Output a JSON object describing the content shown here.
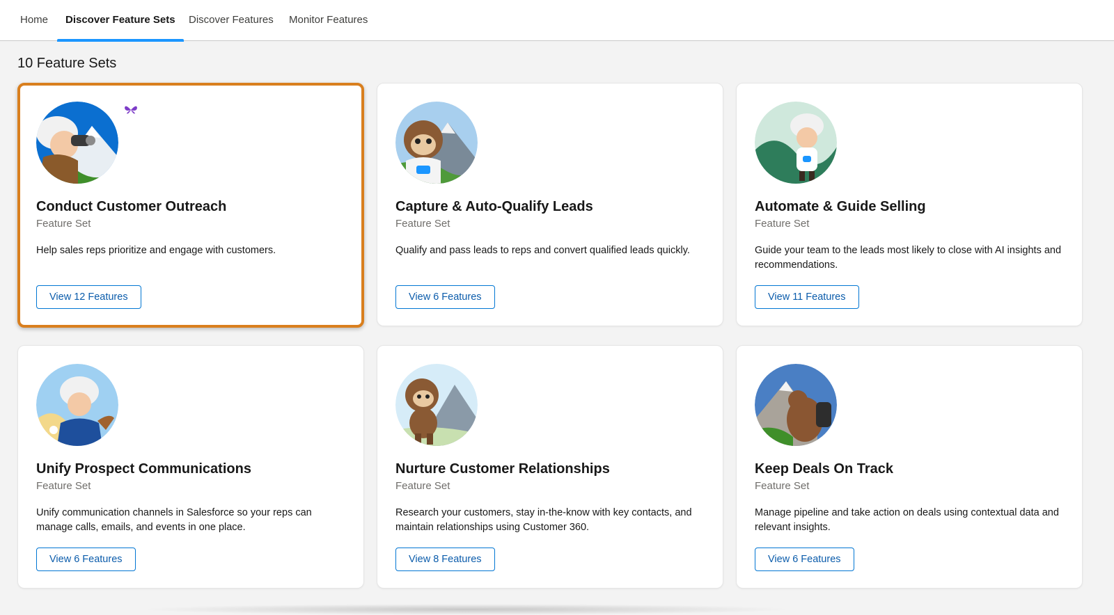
{
  "nav": {
    "tabs": [
      {
        "label": "Home"
      },
      {
        "label": "Discover Feature Sets"
      },
      {
        "label": "Discover Features"
      },
      {
        "label": "Monitor Features"
      }
    ],
    "active_tab": "Discover Feature Sets",
    "accent_color": "#1b96ff"
  },
  "main": {
    "count_label": "10 Feature Sets",
    "cards": [
      {
        "title": "Conduct Customer Outreach",
        "subtitle": "Feature Set",
        "description": "Help sales reps prioritize and engage with customers.",
        "button": "View 12 Features",
        "image": "einstein-binoculars-illustration",
        "focused": true
      },
      {
        "title": "Capture & Auto-Qualify Leads",
        "subtitle": "Feature Set",
        "description": "Qualify and pass leads to reps and convert qualified leads quickly.",
        "button": "View 6 Features",
        "image": "astro-mountains-illustration"
      },
      {
        "title": "Automate & Guide Selling",
        "subtitle": "Feature Set",
        "description": "Guide your team to the leads most likely to close with AI insights and recommendations.",
        "button": "View 11 Features",
        "image": "einstein-waving-illustration"
      },
      {
        "title": "Unify Prospect Communications",
        "subtitle": "Feature Set",
        "description": "Unify communication channels in Salesforce so your reps can manage calls, emails, and events in one place.",
        "button": "View 6 Features",
        "image": "einstein-flowers-illustration"
      },
      {
        "title": "Nurture Customer Relationships",
        "subtitle": "Feature Set",
        "description": "Research your customers, stay in-the-know with key contacts, and maintain relationships using Customer 360.",
        "button": "View 8 Features",
        "image": "astro-walking-illustration"
      },
      {
        "title": "Keep Deals On Track",
        "subtitle": "Feature Set",
        "description": "Manage pipeline and take action on deals using contextual data and relevant insights.",
        "button": "View 6 Features",
        "image": "bear-backpack-illustration"
      }
    ]
  },
  "colors": {
    "button_border": "#0176d3",
    "button_text": "#0b5cab",
    "focus_outline": "#d97f1e",
    "page_background": "#f3f3f3"
  }
}
